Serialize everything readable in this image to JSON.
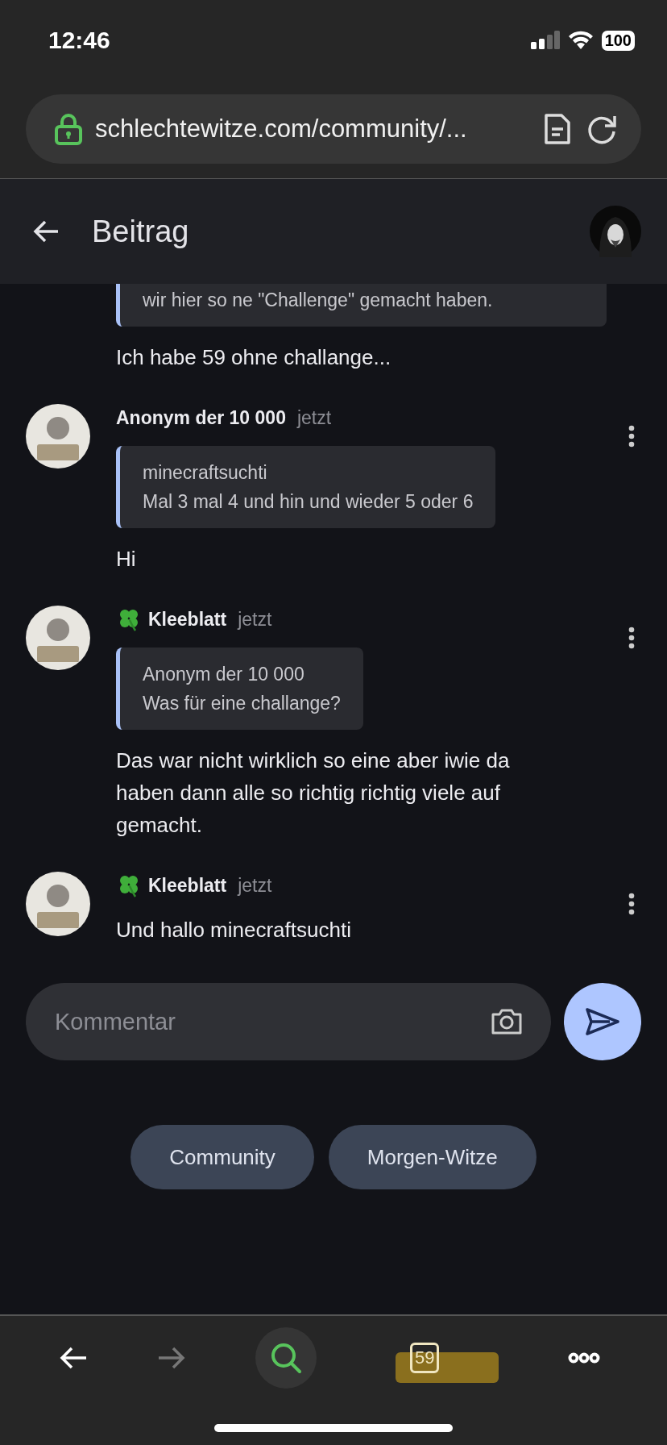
{
  "status_bar": {
    "time": "12:46",
    "battery": "100"
  },
  "browser": {
    "url": "schlechtewitze.com/community/...",
    "secure": true
  },
  "header": {
    "title": "Beitrag"
  },
  "partial_comment": {
    "quote_text": "wir hier so ne \"Challenge\" gemacht haben.",
    "body": "Ich habe 59 ohne challange..."
  },
  "comments": [
    {
      "author": "Anonym der 10 000",
      "clover": false,
      "time": "jetzt",
      "quote": {
        "author": "minecraftsuchti",
        "text": "Mal 3 mal 4 und hin und wieder 5 oder 6"
      },
      "body": "Hi"
    },
    {
      "author": "Kleeblatt",
      "clover": true,
      "time": "jetzt",
      "quote": {
        "author": "Anonym der 10 000",
        "text": "Was für eine challange?"
      },
      "body": "Das war nicht wirklich so eine aber iwie da haben dann alle so richtig richtig viele auf gemacht."
    },
    {
      "author": "Kleeblatt",
      "clover": true,
      "time": "jetzt",
      "body": "Und hallo minecraftsuchti"
    }
  ],
  "composer": {
    "placeholder": "Kommentar"
  },
  "chips": [
    "Community",
    "Morgen-Witze"
  ],
  "toolbar": {
    "back_disabled": false,
    "forward_disabled": true,
    "search_selected": true,
    "tab_count": "59",
    "tab_highlighted": true
  }
}
